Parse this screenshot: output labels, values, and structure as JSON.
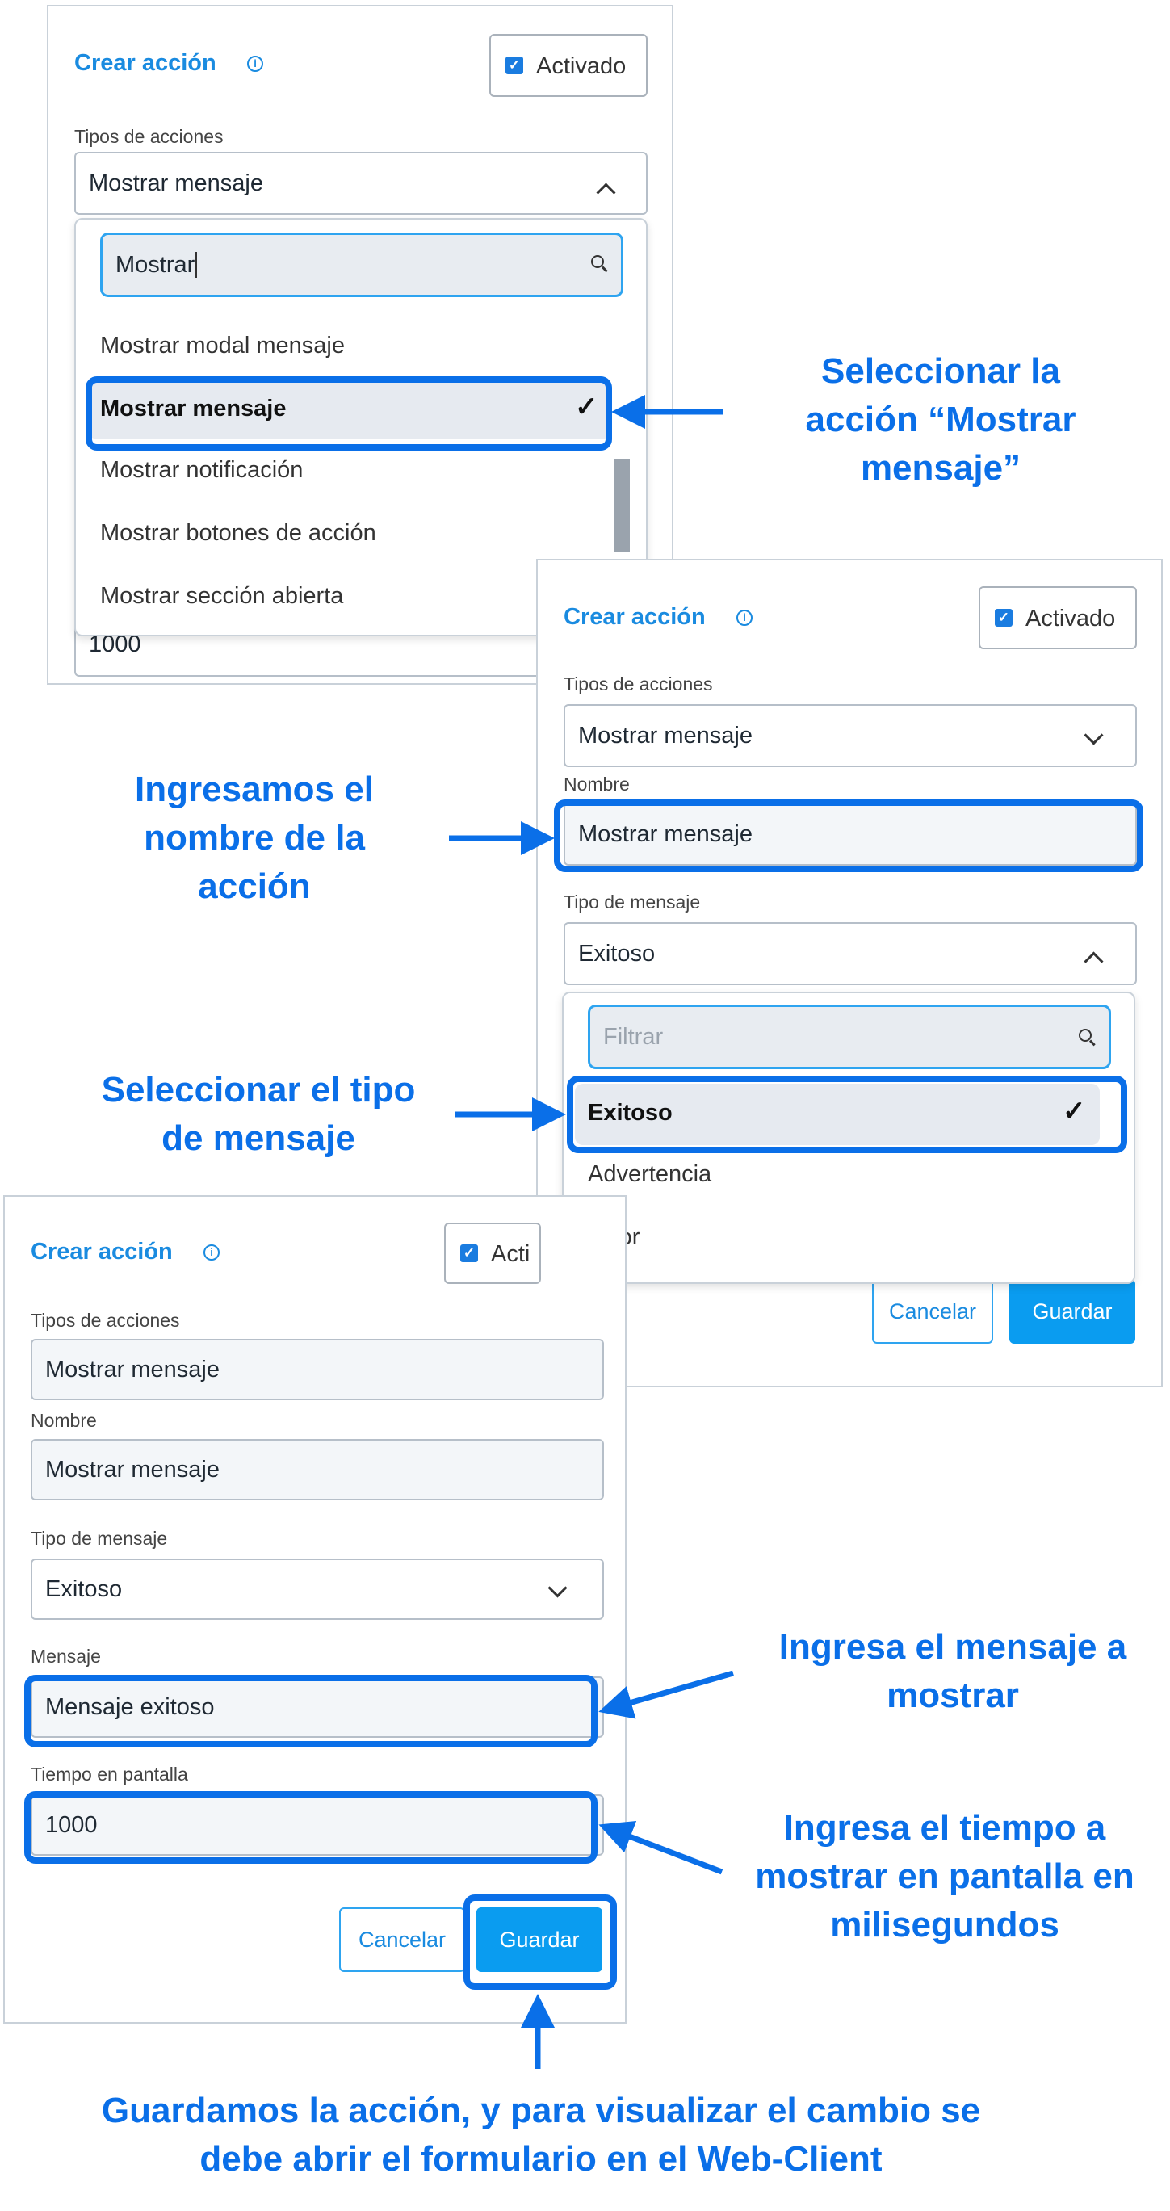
{
  "colors": {
    "accent": "#1a8be0",
    "highlight": "#0a6fe8",
    "save": "#0a9cf0"
  },
  "panel1": {
    "title": "Crear acción",
    "activated_label": "Activado",
    "actions_type_label": "Tipos de acciones",
    "actions_type_value": "Mostrar mensaje",
    "search_value": "Mostrar",
    "options": [
      "Mostrar modal mensaje",
      "Mostrar mensaje",
      "Mostrar notificación",
      "Mostrar botones de acción",
      "Mostrar sección abierta"
    ],
    "hidden_value": "1000"
  },
  "panel2": {
    "title": "Crear acción",
    "activated_label": "Activado",
    "actions_type_label": "Tipos de acciones",
    "actions_type_value": "Mostrar mensaje",
    "name_label": "Nombre",
    "name_value": "Mostrar mensaje",
    "message_type_label": "Tipo de mensaje",
    "message_type_value": "Exitoso",
    "filter_placeholder": "Filtrar",
    "options": [
      "Exitoso",
      "Advertencia",
      "Error"
    ],
    "cancel_label": "Cancelar",
    "save_label": "Guardar"
  },
  "panel3": {
    "title": "Crear acción",
    "activated_label": "Acti",
    "actions_type_label": "Tipos de acciones",
    "actions_type_value": "Mostrar mensaje",
    "name_label": "Nombre",
    "name_value": "Mostrar mensaje",
    "message_type_label": "Tipo de mensaje",
    "message_type_value": "Exitoso",
    "message_label": "Mensaje",
    "message_value": "Mensaje exitoso",
    "time_label": "Tiempo en pantalla",
    "time_value": "1000",
    "cancel_label": "Cancelar",
    "save_label": "Guardar"
  },
  "annotations": {
    "select_action": "Seleccionar la acción “Mostrar mensaje”",
    "enter_name": "Ingresamos el nombre de la acción",
    "select_type": "Seleccionar el tipo de mensaje",
    "enter_message": "Ingresa el mensaje a mostrar",
    "enter_time": "Ingresa el tiempo a mostrar en pantalla en milisegundos",
    "save_note": "Guardamos la acción, y para visualizar el cambio se debe abrir el formulario en el Web-Client"
  }
}
